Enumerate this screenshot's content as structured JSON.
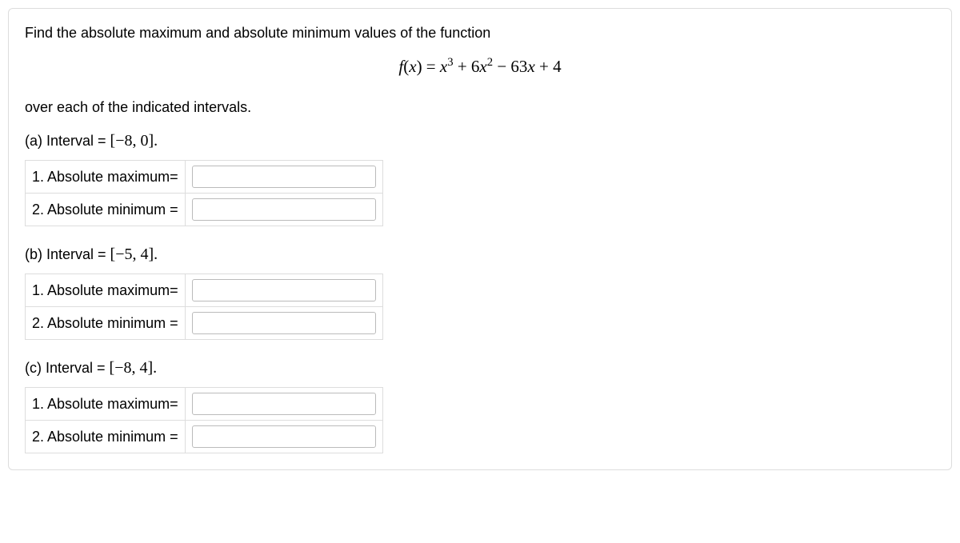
{
  "intro": "Find the absolute maximum and absolute minimum values of the function",
  "equation_html": "<span class='math'>f</span>(<span class='math'>x</span>) = <span class='math'>x</span><sup>3</sup> + 6<span class='math'>x</span><sup>2</sup> − 63<span class='math'>x</span> + 4",
  "over_text": "over each of the indicated intervals.",
  "parts": {
    "a": {
      "prefix": "(a) Interval = ",
      "interval": "[−8, 0]",
      "max_label": "1.  Absolute maximum=",
      "min_label": "2.  Absolute minimum ="
    },
    "b": {
      "prefix": "(b) Interval = ",
      "interval": "[−5, 4]",
      "max_label": "1.  Absolute maximum=",
      "min_label": "2.  Absolute minimum ="
    },
    "c": {
      "prefix": "(c) Interval = ",
      "interval": "[−8, 4]",
      "max_label": "1.  Absolute maximum=",
      "min_label": "2.  Absolute minimum ="
    }
  }
}
